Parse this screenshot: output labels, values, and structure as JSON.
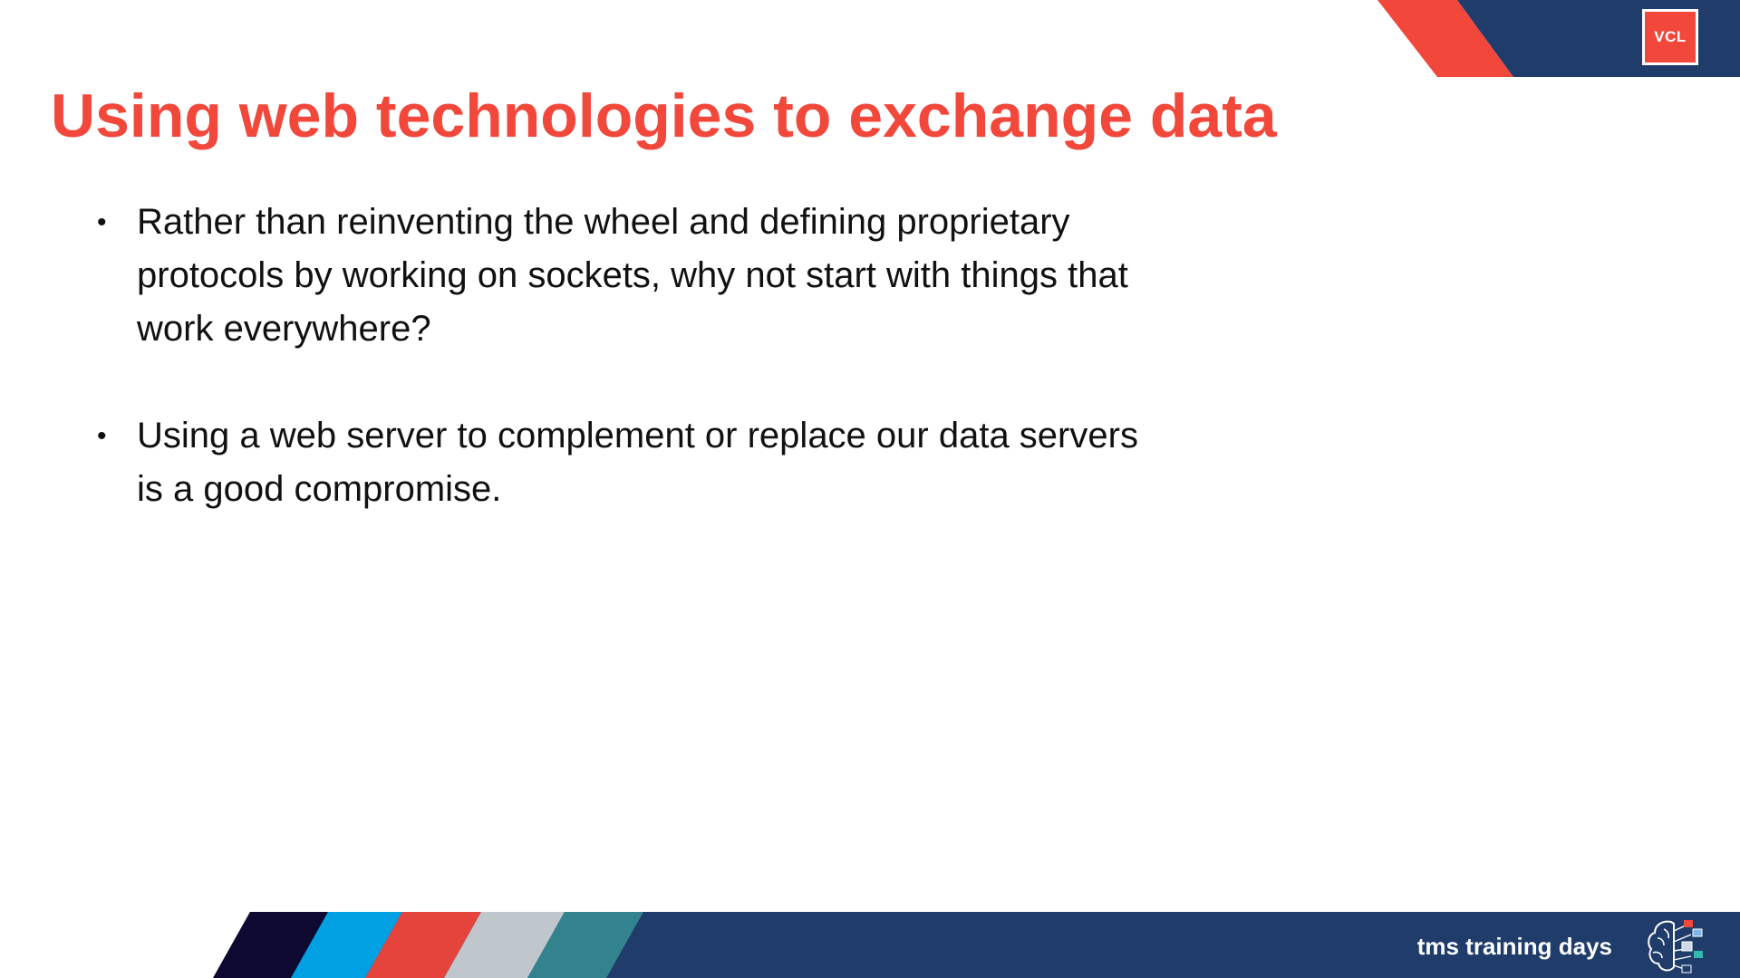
{
  "badge": {
    "label": "VCL"
  },
  "title": "Using web technologies to exchange data",
  "bullets": [
    {
      "text": "Rather than reinventing the wheel and defining proprietary protocols by working on sockets, why not start with things that work everywhere?"
    },
    {
      "text": "Using a web server to complement or replace our data servers is a good compromise."
    }
  ],
  "footer": {
    "brand": "tms training days"
  },
  "icons": {
    "bullet": "•",
    "logo": "brain-network-icon"
  },
  "colors": {
    "accent_red": "#f2473b",
    "navy": "#1f3c6b",
    "dark_navy": "#0d0930",
    "blue": "#00a0e3",
    "gray": "#bfc6cc",
    "teal": "#33838e"
  }
}
